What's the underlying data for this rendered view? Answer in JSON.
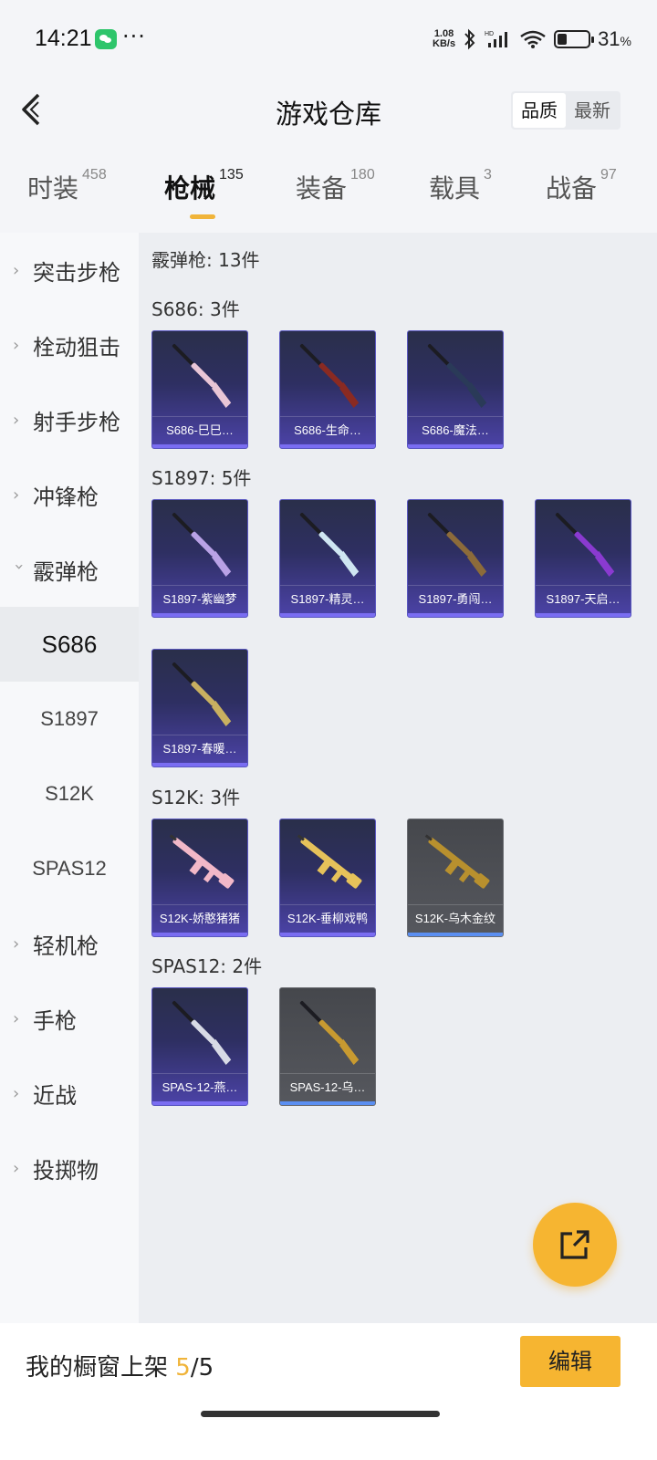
{
  "status": {
    "time": "14:21",
    "net_speed": "1.08",
    "net_unit": "KB/s",
    "battery": "31",
    "battery_unit": "%",
    "battery_level": 0.31
  },
  "header": {
    "title": "游戏仓库",
    "sort_options": [
      "品质",
      "最新"
    ],
    "sort_selected": 0
  },
  "tabs": [
    {
      "label": "时装",
      "count": "458"
    },
    {
      "label": "枪械",
      "count": "135",
      "active": true
    },
    {
      "label": "装备",
      "count": "180"
    },
    {
      "label": "载具",
      "count": "3"
    },
    {
      "label": "战备",
      "count": "97"
    }
  ],
  "sidebar": {
    "categories": [
      "突击步枪",
      "栓动狙击",
      "射手步枪",
      "冲锋枪",
      "霰弹枪",
      "轻机枪",
      "手枪",
      "近战",
      "投掷物"
    ],
    "expanded": "霰弹枪",
    "subitems": [
      "S686",
      "S1897",
      "S12K",
      "SPAS12"
    ],
    "active_sub": "S686"
  },
  "content": {
    "summary": "霰弹枪: 13件",
    "groups": [
      {
        "header": "S686: 3件",
        "items": [
          {
            "name": "S686-巳巳…",
            "quality": "purple",
            "color": "#e9c6d6"
          },
          {
            "name": "S686-生命…",
            "quality": "purple",
            "color": "#8a2a22"
          },
          {
            "name": "S686-魔法…",
            "quality": "purple",
            "color": "#2a3a58"
          }
        ]
      },
      {
        "header": "S1897: 5件",
        "items": [
          {
            "name": "S1897-紫幽梦",
            "quality": "purple",
            "color": "#b9a2e6"
          },
          {
            "name": "S1897-精灵…",
            "quality": "purple",
            "color": "#cfe6f2"
          },
          {
            "name": "S1897-勇闯…",
            "quality": "purple",
            "color": "#8c6b3a"
          },
          {
            "name": "S1897-天启…",
            "quality": "purple",
            "color": "#8a3ad0"
          },
          {
            "name": "S1897-春暖…",
            "quality": "purple",
            "color": "#c9b060"
          }
        ]
      },
      {
        "header": "S12K: 3件",
        "items": [
          {
            "name": "S12K-娇憨猪猪",
            "quality": "purple",
            "color": "#f2b8c8"
          },
          {
            "name": "S12K-垂柳戏鸭",
            "quality": "purple",
            "color": "#e6c25a"
          },
          {
            "name": "S12K-乌木金纹",
            "quality": "grey",
            "color": "#b8902e"
          }
        ]
      },
      {
        "header": "SPAS12: 2件",
        "items": [
          {
            "name": "SPAS-12-燕…",
            "quality": "purple",
            "color": "#d8dbe6"
          },
          {
            "name": "SPAS-12-乌…",
            "quality": "grey",
            "color": "#c89a30"
          }
        ]
      }
    ]
  },
  "footer": {
    "label": "我的橱窗上架",
    "current": "5",
    "sep": "/",
    "total": "5",
    "edit_label": "编辑"
  },
  "colors": {
    "accent": "#f6b531",
    "purple_quality": "#7a6df2",
    "grey_quality": "#5b8ff2"
  }
}
